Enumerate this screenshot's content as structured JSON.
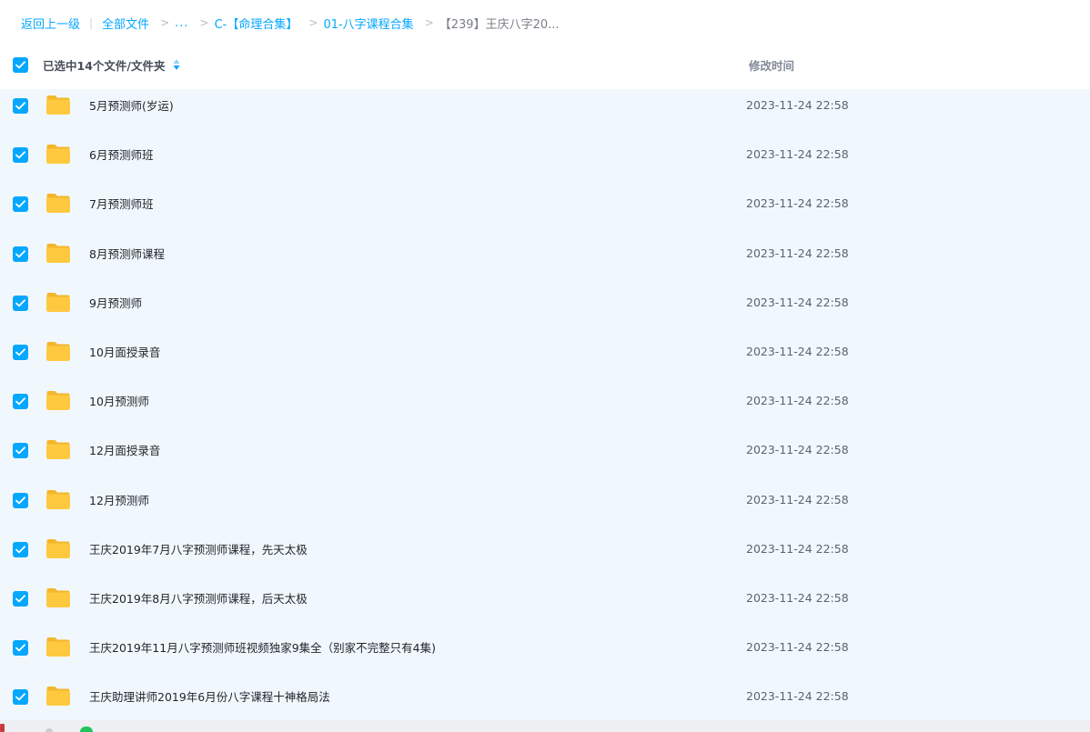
{
  "breadcrumb": {
    "back": "返回上一级",
    "all_files": "全部文件",
    "ellipsis": "...",
    "level1": "C-【命理合集】",
    "level2": "01-八字课程合集",
    "current": "【239】王庆八字20..."
  },
  "header": {
    "selected_label": "已选中14个文件/文件夹",
    "modified_label": "修改时间",
    "all_checked": true,
    "sort_icon": "sort-icon"
  },
  "rows": [
    {
      "name": "5月预测师(岁运)",
      "date": "2023-11-24 22:58",
      "checked": true,
      "icon": "folder-icon"
    },
    {
      "name": "6月预测师班",
      "date": "2023-11-24 22:58",
      "checked": true,
      "icon": "folder-icon"
    },
    {
      "name": "7月预测师班",
      "date": "2023-11-24 22:58",
      "checked": true,
      "icon": "folder-icon"
    },
    {
      "name": "8月预测师课程",
      "date": "2023-11-24 22:58",
      "checked": true,
      "icon": "folder-icon"
    },
    {
      "name": "9月预测师",
      "date": "2023-11-24 22:58",
      "checked": true,
      "icon": "folder-icon"
    },
    {
      "name": "10月面授录音",
      "date": "2023-11-24 22:58",
      "checked": true,
      "icon": "folder-icon"
    },
    {
      "name": "10月预测师",
      "date": "2023-11-24 22:58",
      "checked": true,
      "icon": "folder-icon"
    },
    {
      "name": "12月面授录音",
      "date": "2023-11-24 22:58",
      "checked": true,
      "icon": "folder-icon"
    },
    {
      "name": "12月预测师",
      "date": "2023-11-24 22:58",
      "checked": true,
      "icon": "folder-icon"
    },
    {
      "name": "王庆2019年7月八字预测师课程，先天太极",
      "date": "2023-11-24 22:58",
      "checked": true,
      "icon": "folder-icon"
    },
    {
      "name": "王庆2019年8月八字预测师课程，后天太极",
      "date": "2023-11-24 22:58",
      "checked": true,
      "icon": "folder-icon"
    },
    {
      "name": "王庆2019年11月八字预测师班视频独家9集全（别家不完整只有4集)",
      "date": "2023-11-24 22:58",
      "checked": true,
      "icon": "folder-icon"
    },
    {
      "name": "王庆助理讲师2019年6月份八字课程十神格局法",
      "date": "2023-11-24 22:58",
      "checked": true,
      "icon": "folder-icon"
    }
  ],
  "colors": {
    "accent": "#06a7ff",
    "selected_row_bg": "#f1f8fd",
    "folder_yellow": "#ffc83d"
  }
}
